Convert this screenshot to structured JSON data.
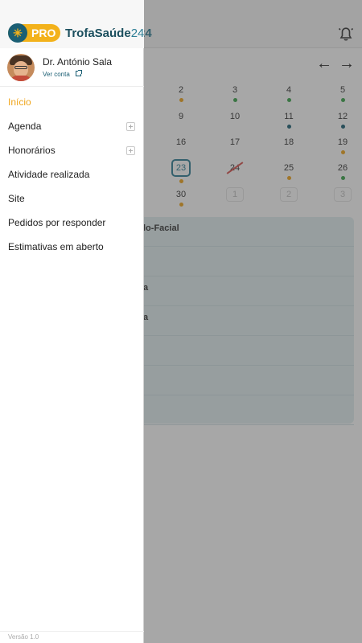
{
  "background": {
    "title_fragment": "24",
    "calendar": {
      "rows": [
        [
          {
            "n": "2",
            "dot": "#f0a51a"
          },
          {
            "n": "3",
            "dot": "#3aa54a"
          },
          {
            "n": "4",
            "dot": "#3aa54a"
          },
          {
            "n": "5",
            "dot": "#3aa54a"
          }
        ],
        [
          {
            "n": "9",
            "dot": ""
          },
          {
            "n": "10",
            "dot": ""
          },
          {
            "n": "11",
            "dot": "#1b5f74"
          },
          {
            "n": "12",
            "dot": "#1b5f74"
          }
        ],
        [
          {
            "n": "16",
            "dot": ""
          },
          {
            "n": "17",
            "dot": ""
          },
          {
            "n": "18",
            "dot": ""
          },
          {
            "n": "19",
            "dot": "#f0a51a"
          }
        ],
        [
          {
            "n": "23",
            "dot": "#f0a51a",
            "today": true
          },
          {
            "n": "24",
            "dot": "",
            "crossed": true
          },
          {
            "n": "25",
            "dot": "#f0a51a"
          },
          {
            "n": "26",
            "dot": "#3aa54a"
          }
        ],
        [
          {
            "n": "30",
            "dot": "#f0a51a"
          },
          {
            "n": "1",
            "dot": "",
            "muted": true
          },
          {
            "n": "2",
            "dot": "",
            "muted": true
          },
          {
            "n": "3",
            "dot": "",
            "muted": true
          }
        ]
      ]
    },
    "card_rows": [
      "lo-Facial",
      "",
      "a",
      "a",
      "",
      "",
      ""
    ]
  },
  "drawer": {
    "brand": {
      "pro": "PRO",
      "name": "TrofaSaúde",
      "name_num": "24"
    },
    "profile": {
      "name": "Dr. António Sala",
      "link": "Ver conta"
    },
    "menu": [
      {
        "label": "Início",
        "active": true,
        "expandable": false
      },
      {
        "label": "Agenda",
        "active": false,
        "expandable": true
      },
      {
        "label": "Honorários",
        "active": false,
        "expandable": true
      },
      {
        "label": "Atividade realizada",
        "active": false,
        "expandable": false
      },
      {
        "label": "Site",
        "active": false,
        "expandable": false
      },
      {
        "label": "Pedidos por responder",
        "active": false,
        "expandable": false
      },
      {
        "label": "Estimativas em aberto",
        "active": false,
        "expandable": false
      }
    ],
    "version": "Versão 1.0"
  },
  "colors": {
    "accent": "#f0a51a",
    "brand": "#1b5f74",
    "teal": "#2e7f96"
  }
}
